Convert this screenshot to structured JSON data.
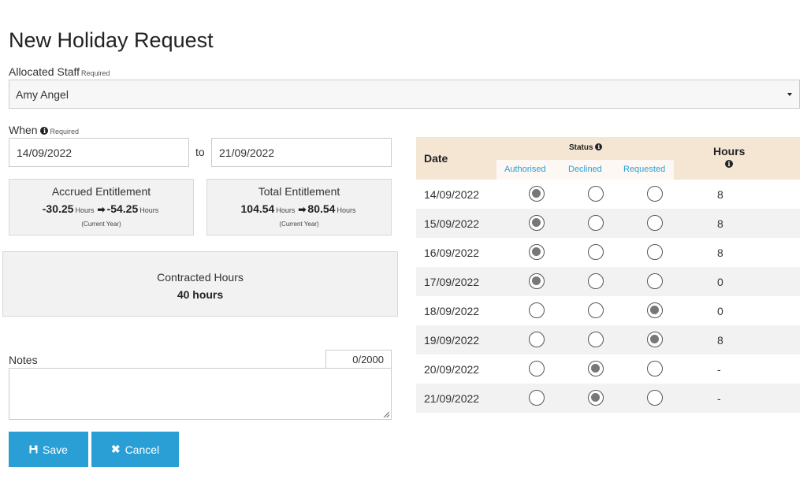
{
  "page": {
    "title": "New Holiday Request"
  },
  "staff": {
    "label": "Allocated Staff",
    "required": "Required",
    "value": "Amy Angel"
  },
  "when": {
    "label": "When",
    "required": "Required",
    "from": "14/09/2022",
    "to_label": "to",
    "to": "21/09/2022"
  },
  "accrued": {
    "title": "Accrued Entitlement",
    "from_value": "-30.25",
    "to_value": "-54.25",
    "unit": "Hours",
    "sub": "(Current Year)"
  },
  "total": {
    "title": "Total Entitlement",
    "from_value": "104.54",
    "to_value": "80.54",
    "unit": "Hours",
    "sub": "(Current Year)"
  },
  "contracted": {
    "title": "Contracted Hours",
    "value": "40 hours"
  },
  "notes": {
    "label": "Notes",
    "counter": "0/2000",
    "value": ""
  },
  "buttons": {
    "save": "Save",
    "cancel": "Cancel"
  },
  "table": {
    "header": {
      "date": "Date",
      "status": "Status",
      "hours": "Hours",
      "authorised": "Authorised",
      "declined": "Declined",
      "requested": "Requested"
    },
    "rows": [
      {
        "date": "14/09/2022",
        "status": "authorised",
        "hours": "8"
      },
      {
        "date": "15/09/2022",
        "status": "authorised",
        "hours": "8"
      },
      {
        "date": "16/09/2022",
        "status": "authorised",
        "hours": "8"
      },
      {
        "date": "17/09/2022",
        "status": "authorised",
        "hours": "0"
      },
      {
        "date": "18/09/2022",
        "status": "requested",
        "hours": "0"
      },
      {
        "date": "19/09/2022",
        "status": "requested",
        "hours": "8"
      },
      {
        "date": "20/09/2022",
        "status": "declined",
        "hours": "-"
      },
      {
        "date": "21/09/2022",
        "status": "declined",
        "hours": "-"
      }
    ]
  },
  "colors": {
    "primary": "#2a9fd6",
    "table_header": "#f5e6d4",
    "panel": "#f2f2f2"
  }
}
